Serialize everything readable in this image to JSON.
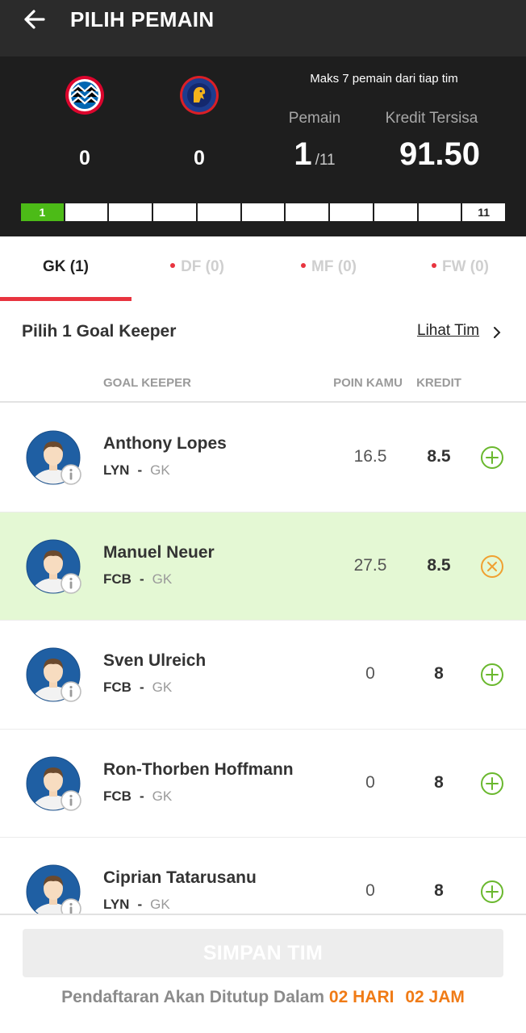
{
  "header": {
    "back_icon": "arrow-left-icon",
    "title": "PILIH PEMAIN"
  },
  "summary": {
    "teams": [
      {
        "logo_icon": "bayern-munich-logo",
        "count": "0",
        "color": "#dc052d"
      },
      {
        "logo_icon": "olympique-lyonnais-logo",
        "count": "0",
        "color": "#1d3c8f"
      }
    ],
    "max_note": "Maks 7 pemain dari tiap tim",
    "players_label": "Pemain",
    "players_selected": "1",
    "players_total": "/11",
    "credit_label": "Kredit Tersisa",
    "credit_remaining": "91.50",
    "progress": {
      "filled": 1,
      "total": 11,
      "first_label": "1",
      "last_label": "11",
      "fill_color": "#4cbb17"
    }
  },
  "tabs": [
    {
      "label": "GK (1)",
      "active": true
    },
    {
      "label": "DF (0)",
      "active": false
    },
    {
      "label": "MF (0)",
      "active": false
    },
    {
      "label": "FW (0)",
      "active": false
    }
  ],
  "section": {
    "title": "Pilih 1 Goal Keeper",
    "link": "Lihat Tim"
  },
  "columns": {
    "position": "GOAL KEEPER",
    "points": "POIN KAMU",
    "credit": "KREDIT"
  },
  "players": [
    {
      "name": "Anthony Lopes",
      "team": "LYN",
      "sep": "-",
      "pos": "GK",
      "points": "16.5",
      "credit": "8.5",
      "selected": false
    },
    {
      "name": "Manuel Neuer",
      "team": "FCB",
      "sep": "-",
      "pos": "GK",
      "points": "27.5",
      "credit": "8.5",
      "selected": true
    },
    {
      "name": "Sven Ulreich",
      "team": "FCB",
      "sep": "-",
      "pos": "GK",
      "points": "0",
      "credit": "8",
      "selected": false
    },
    {
      "name": "Ron-Thorben Hoffmann",
      "team": "FCB",
      "sep": "-",
      "pos": "GK",
      "points": "0",
      "credit": "8",
      "selected": false
    },
    {
      "name": "Ciprian Tatarusanu",
      "team": "LYN",
      "sep": "-",
      "pos": "GK",
      "points": "0",
      "credit": "8",
      "selected": false
    }
  ],
  "footer": {
    "save_label": "SIMPAN TIM",
    "deadline_prefix": "Pendaftaran Akan Ditutup Dalam",
    "days_value": "02",
    "days_unit": "HARI",
    "hours_value": "02",
    "hours_unit": "JAM"
  },
  "colors": {
    "accent_red": "#e8343f",
    "add_green": "#6ab82e",
    "remove_orange": "#f0a030",
    "selected_row": "#e4f8d4",
    "deadline_orange": "#f07b16"
  }
}
